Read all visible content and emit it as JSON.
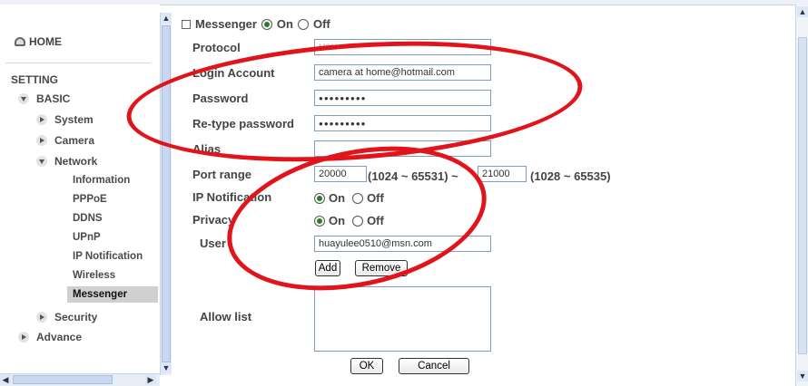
{
  "sidebar": {
    "home": "HOME",
    "setting": "SETTING",
    "basic": "BASIC",
    "items": [
      "System",
      "Camera",
      "Network"
    ],
    "network_items": [
      "Information",
      "PPPoE",
      "DDNS",
      "UPnP",
      "IP Notification",
      "Wireless",
      "Messenger"
    ],
    "security": "Security",
    "advance": "Advance"
  },
  "messenger": {
    "title": "Messenger",
    "on": "On",
    "off": "Off"
  },
  "form": {
    "protocol_label": "Protocol",
    "protocol_value": "MSN",
    "login_label": "Login Account",
    "login_value": "camera at home@hotmail.com",
    "password_label": "Password",
    "password_value": "●●●●●●●●●",
    "retype_label": "Re-type password",
    "retype_value": "●●●●●●●●●",
    "alias_label": "Alias",
    "alias_value": "",
    "port_label": "Port range",
    "port_from": "20000",
    "port_from_range": "(1024 ~ 65531) ~",
    "port_to": "21000",
    "port_to_range": "(1028 ~ 65535)",
    "ipnotify_label": "IP Notification",
    "privacy_label": "Privacy",
    "on": "On",
    "off": "Off",
    "user_label": "User",
    "user_value": "huayulee0510@msn.com",
    "add": "Add",
    "remove": "Remove",
    "allow_label": "Allow list",
    "ok": "OK",
    "cancel": "Cancel"
  },
  "colors": {
    "annotation": "#e0141a",
    "radio_selected": "#2a7d2a"
  }
}
